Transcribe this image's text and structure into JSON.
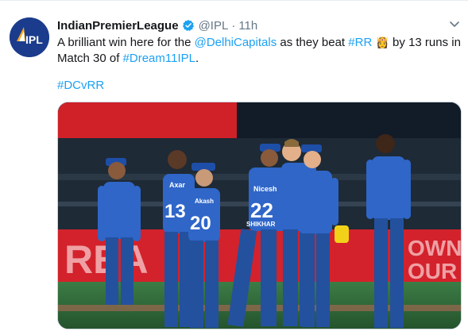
{
  "tweet": {
    "display_name": "IndianPremierLeague",
    "handle": "@IPL",
    "separator": "·",
    "time": "11h",
    "avatar_text": "IPL",
    "text_parts": {
      "p1": "A brilliant win here for the ",
      "mention": "@DelhiCapitals",
      "p2": " as they beat ",
      "hashtag_rr": "#RR",
      "emoji": "👸",
      "p3": " by 13 runs in Match 30 of ",
      "hashtag_dream": "#Dream11IPL",
      "p4": "."
    },
    "hashtag_line": "#DCvRR",
    "media": {
      "jersey_numbers": [
        "13",
        "20",
        "22"
      ],
      "jersey_names": [
        "Axar",
        "Akash",
        "SHIKHAR"
      ],
      "board_text": [
        "REA",
        "OWN",
        "OUR"
      ]
    }
  },
  "colors": {
    "link": "#1da1f2",
    "verified": "#1da1f2",
    "text": "#14171a",
    "muted": "#657786",
    "jersey_blue": "#2f66c8",
    "pitch_green": "#2f6b3a"
  },
  "icons": {
    "verified": "verified-badge-icon",
    "caret": "chevron-down-icon"
  }
}
